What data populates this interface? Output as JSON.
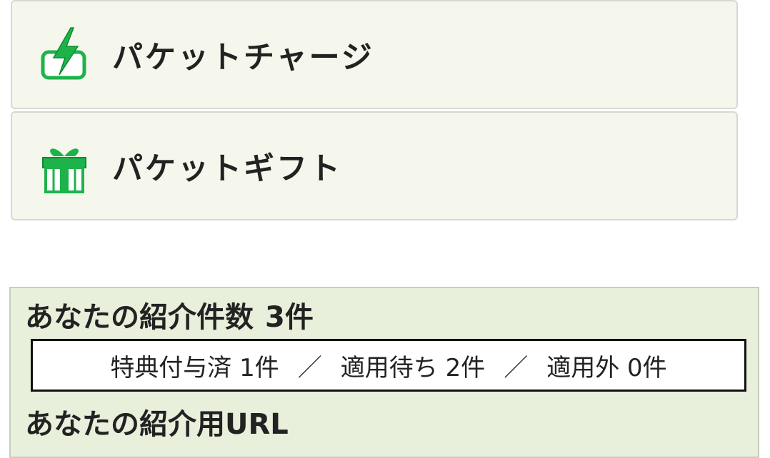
{
  "menu": {
    "items": [
      {
        "label": "パケットチャージ",
        "icon": "charge-battery-icon"
      },
      {
        "label": "パケットギフト",
        "icon": "gift-box-icon"
      }
    ]
  },
  "referral": {
    "count_title": "あなたの紹介件数",
    "count_value": "3件",
    "status": {
      "granted_label": "特典付与済",
      "granted_count": "1件",
      "pending_label": "適用待ち",
      "pending_count": "2件",
      "excluded_label": "適用外",
      "excluded_count": "0件",
      "separator": "／"
    },
    "url_title": "あなたの紹介用URL"
  },
  "colors": {
    "menu_bg": "#f6f7ec",
    "panel_bg": "#e8efdb",
    "icon_green": "#1db34a"
  }
}
